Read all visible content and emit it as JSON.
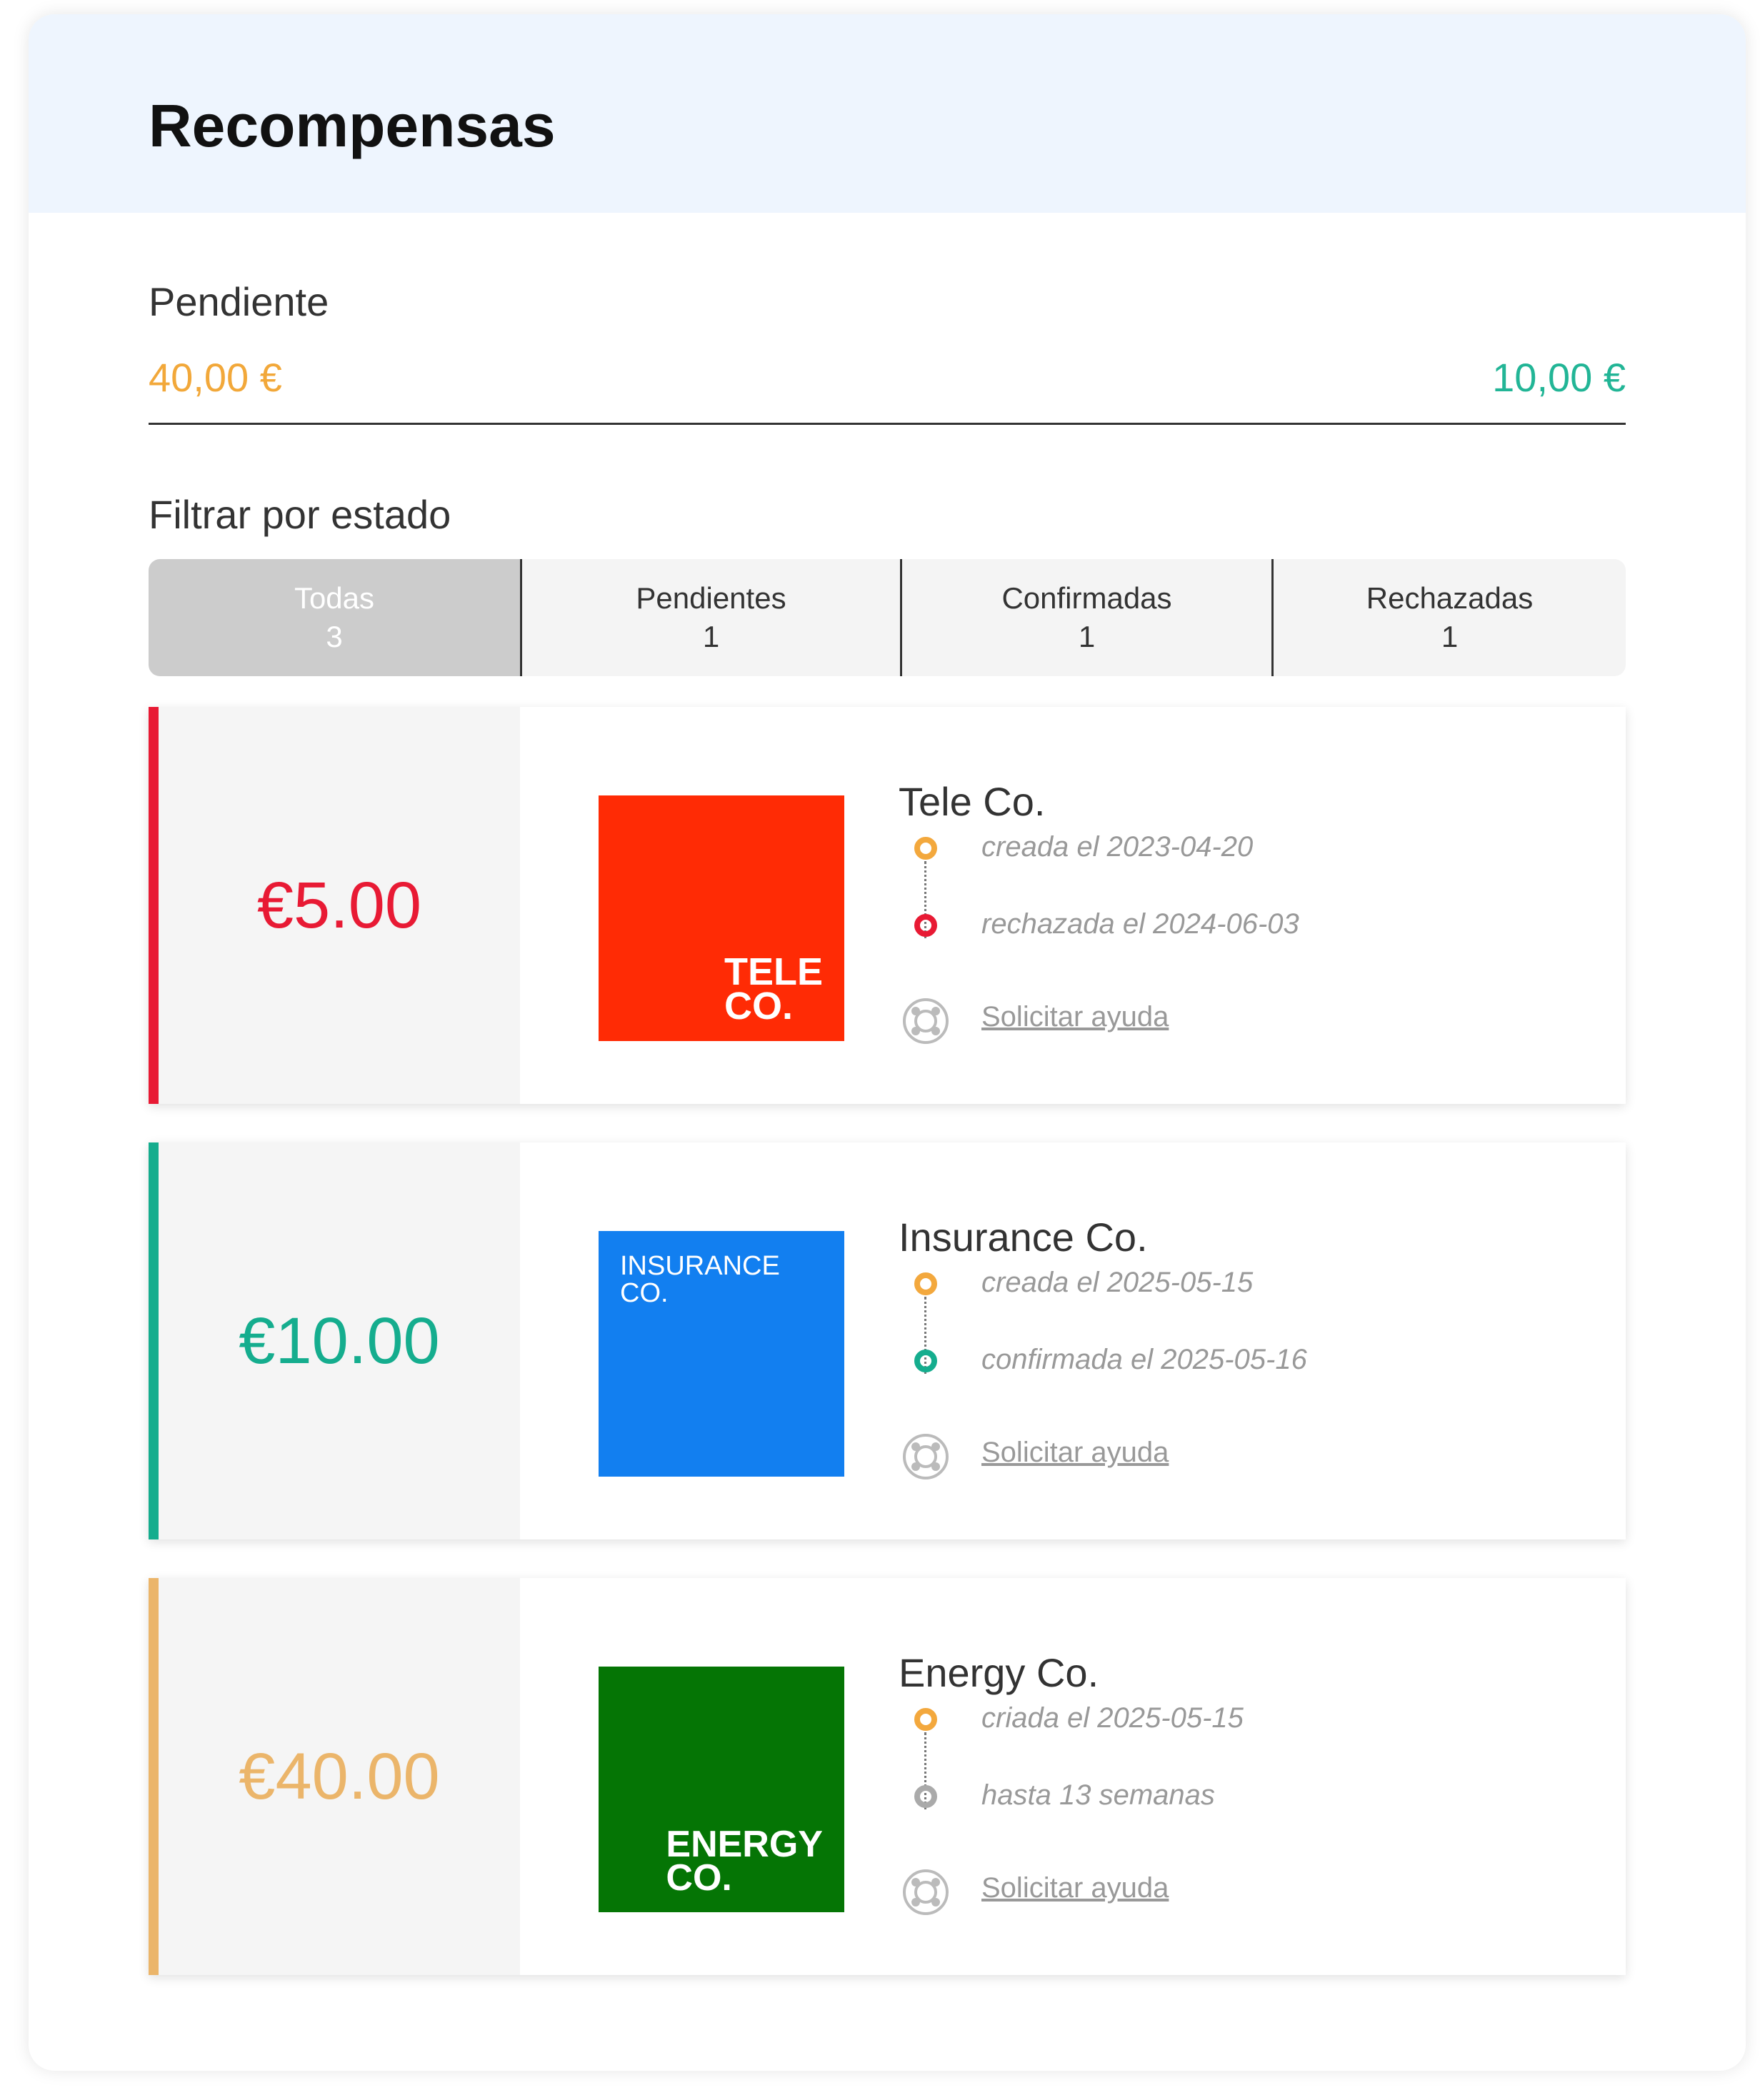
{
  "page": {
    "title": "Recompensas"
  },
  "summary": {
    "pending_label": "Pendiente",
    "pending_amount": "40,00 €",
    "other_amount": "10,00 €"
  },
  "filter": {
    "label": "Filtrar por estado",
    "tabs": [
      {
        "label": "Todas",
        "count": "3",
        "active": true
      },
      {
        "label": "Pendientes",
        "count": "1"
      },
      {
        "label": "Confirmadas",
        "count": "1"
      },
      {
        "label": "Rechazadas",
        "count": "1"
      }
    ]
  },
  "rewards": [
    {
      "amount": "€5.00",
      "status": "rejected",
      "color": "#e81a34",
      "company": "Tele Co.",
      "logo": {
        "bg": "#ff2b05",
        "line1": "TELE",
        "line2": "CO."
      },
      "event1": "creada el 2023-04-20",
      "event2": "rechazada el 2024-06-03",
      "help": "Solicitar ayuda"
    },
    {
      "amount": "€10.00",
      "status": "confirmed",
      "color": "#15ad8e",
      "company": "Insurance Co.",
      "logo": {
        "bg": "#127ff0",
        "line1": "INSURANCE",
        "line2": "CO."
      },
      "event1": "creada el 2025-05-15",
      "event2": "confirmada el 2025-05-16",
      "help": "Solicitar ayuda"
    },
    {
      "amount": "€40.00",
      "status": "pending",
      "color": "#ebb56a",
      "company": "Energy Co.",
      "logo": {
        "bg": "#057505",
        "line1": "ENERGY",
        "line2": "CO."
      },
      "event1": "criada el 2025-05-15",
      "event2": "hasta 13 semanas",
      "help": "Solicitar ayuda"
    }
  ],
  "colors": {
    "dot_created": "#f3a83d",
    "dot_rejected": "#e81a34",
    "dot_confirmed": "#15ad8e",
    "dot_pending": "#aaaaaa"
  }
}
